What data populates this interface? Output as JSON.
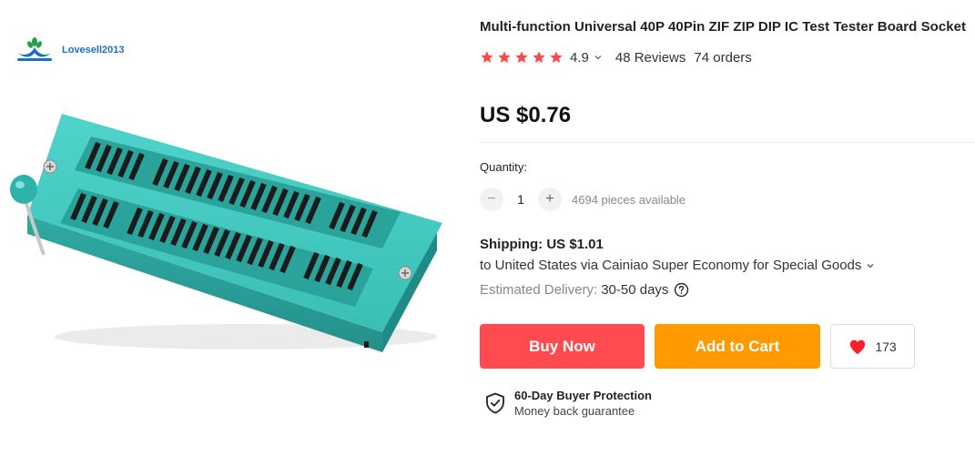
{
  "brand": {
    "name": "Lovesell2013"
  },
  "product": {
    "title": "Multi-function Universal 40P 40Pin ZIF ZIP DIP IC Test Tester Board Socket",
    "image_icon": "zif-socket-image",
    "rating": "4.9",
    "stars": 5,
    "reviews": "48 Reviews",
    "orders": "74 orders",
    "price": "US $0.76"
  },
  "quantity": {
    "label": "Quantity:",
    "value": "1",
    "minus": "−",
    "plus": "+",
    "available": "4694 pieces available"
  },
  "shipping": {
    "title": "Shipping: US $1.01",
    "route": "to United States via Cainiao Super Economy for Special Goods",
    "delivery_label": "Estimated Delivery:",
    "delivery_days": "30-50 days"
  },
  "actions": {
    "buy_now": "Buy Now",
    "add_to_cart": "Add to Cart",
    "wishlist_count": "173"
  },
  "protection": {
    "title": "60-Day Buyer Protection",
    "subtitle": "Money back guarantee"
  },
  "colors": {
    "buy": "#ff4a4f",
    "cart": "#ff9a00",
    "star": "#ff4747",
    "socket": "#3cc4bc"
  }
}
